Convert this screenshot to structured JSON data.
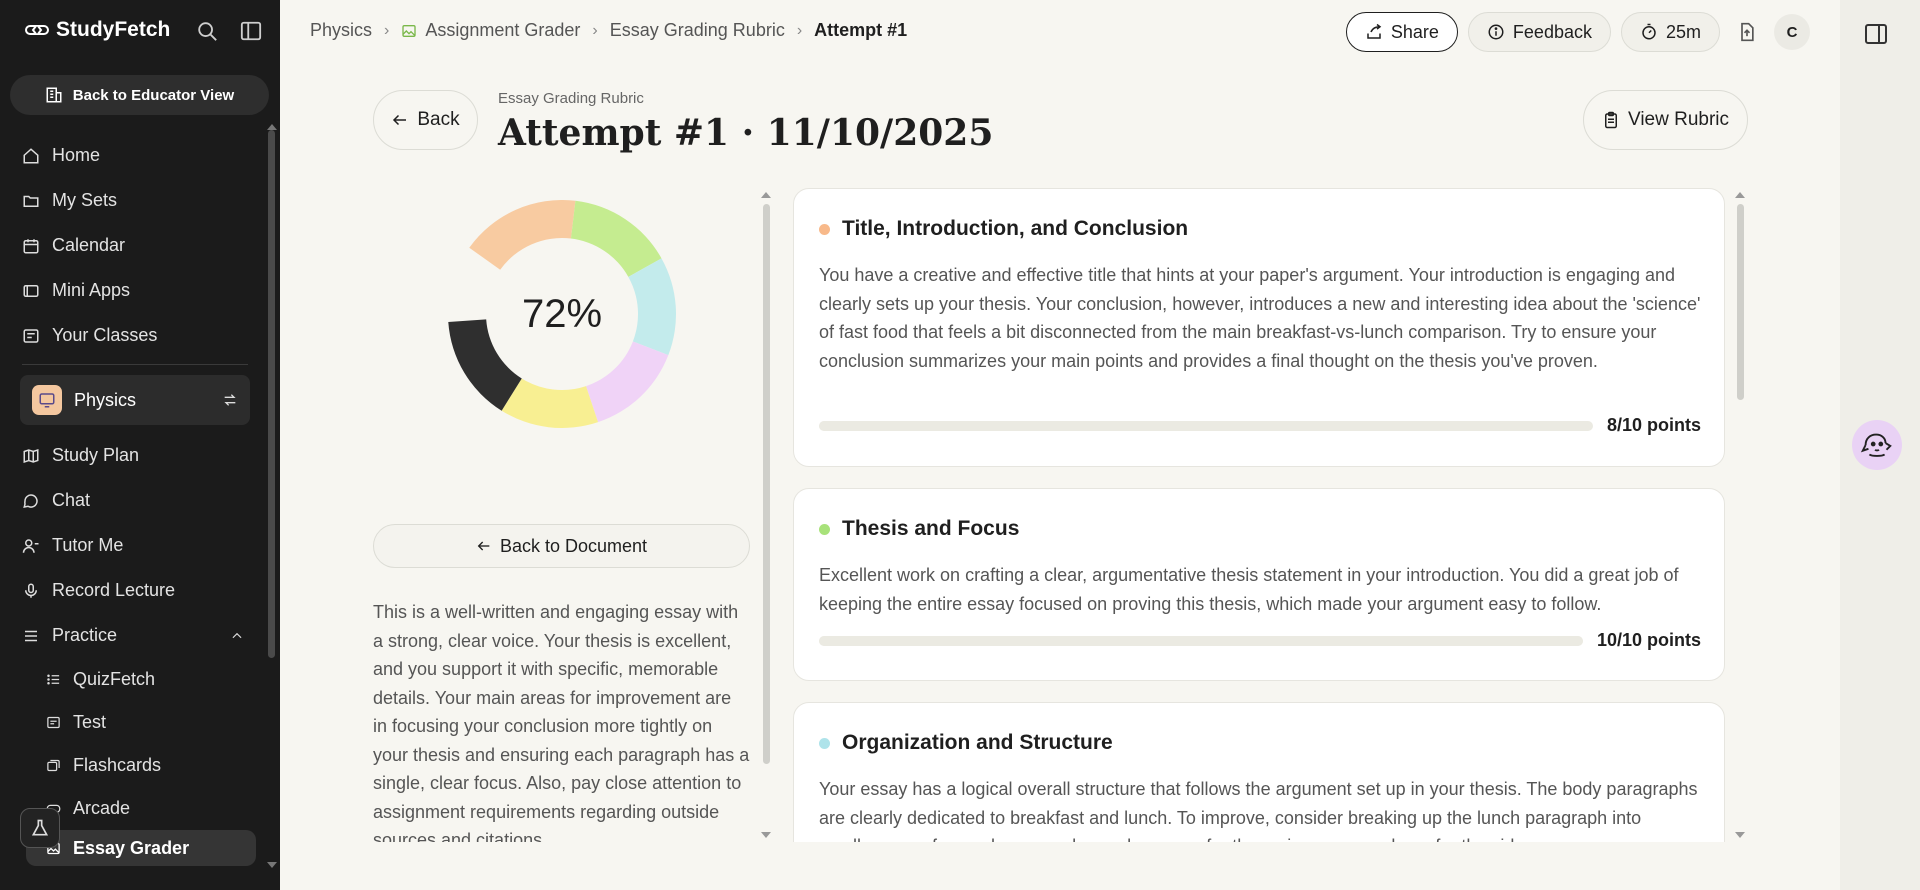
{
  "app": {
    "brand": "StudyFetch"
  },
  "sidebar": {
    "educator_button": "Back to Educator View",
    "nav": [
      {
        "label": "Home",
        "icon": "home-icon"
      },
      {
        "label": "My Sets",
        "icon": "folder-icon"
      },
      {
        "label": "Calendar",
        "icon": "calendar-icon"
      },
      {
        "label": "Mini Apps",
        "icon": "apps-icon"
      },
      {
        "label": "Your Classes",
        "icon": "classes-icon"
      }
    ],
    "class_name": "Physics",
    "nav2": [
      {
        "label": "Study Plan",
        "icon": "map-icon"
      },
      {
        "label": "Chat",
        "icon": "chat-icon"
      },
      {
        "label": "Tutor Me",
        "icon": "tutor-icon"
      },
      {
        "label": "Record Lecture",
        "icon": "mic-icon"
      }
    ],
    "practice_label": "Practice",
    "practice_items": [
      {
        "label": "QuizFetch"
      },
      {
        "label": "Test"
      },
      {
        "label": "Flashcards"
      },
      {
        "label": "Arcade"
      },
      {
        "label": "Essay Grader"
      }
    ]
  },
  "breadcrumb": {
    "items": [
      "Physics",
      "Assignment Grader",
      "Essay Grading Rubric",
      "Attempt #1"
    ]
  },
  "topbar": {
    "share": "Share",
    "feedback": "Feedback",
    "timer": "25m",
    "avatar_initial": "C"
  },
  "header": {
    "back": "Back",
    "eyebrow": "Essay Grading Rubric",
    "title": "Attempt #1 · 11/10/2025",
    "view_rubric": "View Rubric"
  },
  "score": {
    "label": "72%",
    "segments": [
      {
        "color": "#f8cba1",
        "fraction": 0.17
      },
      {
        "color": "#c5ec90",
        "fraction": 0.15
      },
      {
        "color": "#c3ebec",
        "fraction": 0.14
      },
      {
        "color": "#f0d3f7",
        "fraction": 0.14
      },
      {
        "color": "#f8ef92",
        "fraction": 0.14
      },
      {
        "color": "#2f2f2f",
        "fraction": 0.15
      }
    ],
    "gap_fraction": 0.11
  },
  "left": {
    "back_to_document": "Back to Document",
    "summary": "This is a well-written and engaging essay with a strong, clear voice. Your thesis is excellent, and you support it with specific, memorable details. Your main areas for improvement are in focusing your conclusion more tightly on your thesis and ensuring each paragraph has a single, clear focus. Also, pay close attention to assignment requirements regarding outside sources and citations."
  },
  "criteria": [
    {
      "title": "Title, Introduction, and Conclusion",
      "color": "#f8b98a",
      "feedback": "You have a creative and effective title that hints at your paper's argument. Your introduction is engaging and clearly sets up your thesis. Your conclusion, however, introduces a new and interesting idea about the 'science' of fast food that feels a bit disconnected from the main breakfast-vs-lunch comparison. Try to ensure your conclusion summarizes your main points and provides a final thought on the thesis you've proven.",
      "points": "8/10 points",
      "score": 0.8
    },
    {
      "title": "Thesis and Focus",
      "color": "#a8e27a",
      "feedback": "Excellent work on crafting a clear, argumentative thesis statement in your introduction. You did a great job of keeping the entire essay focused on proving this thesis, which made your argument easy to follow.",
      "points": "10/10 points",
      "score": 1.0
    },
    {
      "title": "Organization and Structure",
      "color": "#aee3ea",
      "feedback": "Your essay has a logical overall structure that follows the argument set up in your thesis. The body paragraphs are clearly dedicated to breakfast and lunch. To improve, consider breaking up the lunch paragraph into smaller, more focused paragraphs, perhaps one for the main course and one for the sides.",
      "points": "",
      "score": 0
    }
  ]
}
